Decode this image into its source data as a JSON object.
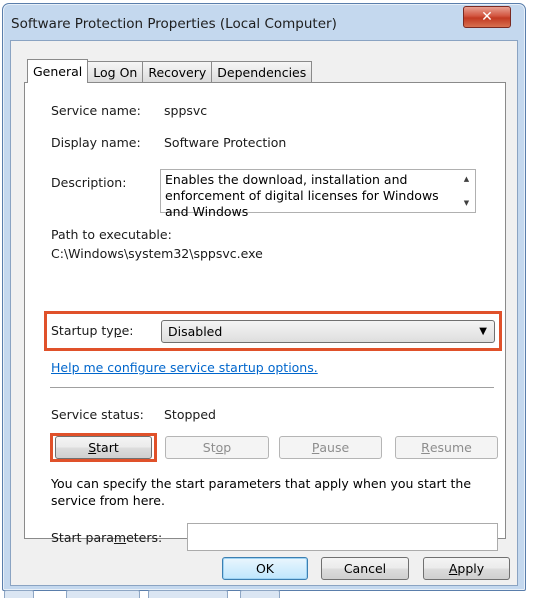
{
  "window": {
    "title": "Software Protection Properties (Local Computer)",
    "close_label": "✕"
  },
  "tabs": [
    {
      "label": "General",
      "active": true
    },
    {
      "label": "Log On",
      "active": false
    },
    {
      "label": "Recovery",
      "active": false
    },
    {
      "label": "Dependencies",
      "active": false
    }
  ],
  "general": {
    "service_name_label": "Service name:",
    "service_name": "sppsvc",
    "display_name_label": "Display name:",
    "display_name": "Software Protection",
    "description_label": "Description:",
    "description": "Enables the download, installation and enforcement of digital licenses for Windows and Windows",
    "path_label": "Path to executable:",
    "path": "C:\\Windows\\system32\\sppsvc.exe",
    "startup_type_label_pre": "Startup ty",
    "startup_type_label_ul": "p",
    "startup_type_label_post": "e:",
    "startup_type": "Disabled",
    "help_link": "Help me configure service startup options.",
    "service_status_label": "Service status:",
    "service_status": "Stopped",
    "start_button_ul": "S",
    "start_button_rest": "tart",
    "stop_button_pre": "St",
    "stop_button_ul": "o",
    "stop_button_post": "p",
    "pause_button_ul": "P",
    "pause_button_rest": "ause",
    "resume_button_ul": "R",
    "resume_button_rest": "esume",
    "info_text": "You can specify the start parameters that apply when you start the service from here.",
    "start_params_label_pre": "Start para",
    "start_params_label_ul": "m",
    "start_params_label_post": "eters:",
    "start_params_value": ""
  },
  "footer": {
    "ok_label": "OK",
    "cancel_label": "Cancel",
    "apply_label_ul": "A",
    "apply_label_rest": "pply"
  },
  "colors": {
    "highlight": "#e0512a",
    "link": "#0066cc",
    "close_button": "#c23a22"
  },
  "icons": {
    "close": "close-icon",
    "dropdown": "chevron-down-icon",
    "scroll_up": "scroll-up-arrow-icon",
    "scroll_down": "scroll-down-arrow-icon"
  }
}
